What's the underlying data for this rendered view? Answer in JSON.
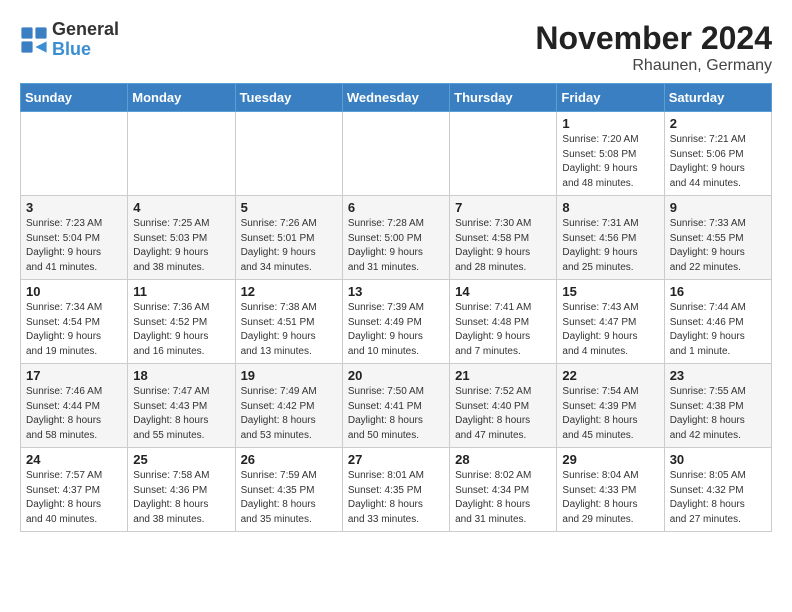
{
  "logo": {
    "general": "General",
    "blue": "Blue"
  },
  "header": {
    "month": "November 2024",
    "location": "Rhaunen, Germany"
  },
  "days_of_week": [
    "Sunday",
    "Monday",
    "Tuesday",
    "Wednesday",
    "Thursday",
    "Friday",
    "Saturday"
  ],
  "weeks": [
    [
      {
        "day": "",
        "info": ""
      },
      {
        "day": "",
        "info": ""
      },
      {
        "day": "",
        "info": ""
      },
      {
        "day": "",
        "info": ""
      },
      {
        "day": "",
        "info": ""
      },
      {
        "day": "1",
        "info": "Sunrise: 7:20 AM\nSunset: 5:08 PM\nDaylight: 9 hours\nand 48 minutes."
      },
      {
        "day": "2",
        "info": "Sunrise: 7:21 AM\nSunset: 5:06 PM\nDaylight: 9 hours\nand 44 minutes."
      }
    ],
    [
      {
        "day": "3",
        "info": "Sunrise: 7:23 AM\nSunset: 5:04 PM\nDaylight: 9 hours\nand 41 minutes."
      },
      {
        "day": "4",
        "info": "Sunrise: 7:25 AM\nSunset: 5:03 PM\nDaylight: 9 hours\nand 38 minutes."
      },
      {
        "day": "5",
        "info": "Sunrise: 7:26 AM\nSunset: 5:01 PM\nDaylight: 9 hours\nand 34 minutes."
      },
      {
        "day": "6",
        "info": "Sunrise: 7:28 AM\nSunset: 5:00 PM\nDaylight: 9 hours\nand 31 minutes."
      },
      {
        "day": "7",
        "info": "Sunrise: 7:30 AM\nSunset: 4:58 PM\nDaylight: 9 hours\nand 28 minutes."
      },
      {
        "day": "8",
        "info": "Sunrise: 7:31 AM\nSunset: 4:56 PM\nDaylight: 9 hours\nand 25 minutes."
      },
      {
        "day": "9",
        "info": "Sunrise: 7:33 AM\nSunset: 4:55 PM\nDaylight: 9 hours\nand 22 minutes."
      }
    ],
    [
      {
        "day": "10",
        "info": "Sunrise: 7:34 AM\nSunset: 4:54 PM\nDaylight: 9 hours\nand 19 minutes."
      },
      {
        "day": "11",
        "info": "Sunrise: 7:36 AM\nSunset: 4:52 PM\nDaylight: 9 hours\nand 16 minutes."
      },
      {
        "day": "12",
        "info": "Sunrise: 7:38 AM\nSunset: 4:51 PM\nDaylight: 9 hours\nand 13 minutes."
      },
      {
        "day": "13",
        "info": "Sunrise: 7:39 AM\nSunset: 4:49 PM\nDaylight: 9 hours\nand 10 minutes."
      },
      {
        "day": "14",
        "info": "Sunrise: 7:41 AM\nSunset: 4:48 PM\nDaylight: 9 hours\nand 7 minutes."
      },
      {
        "day": "15",
        "info": "Sunrise: 7:43 AM\nSunset: 4:47 PM\nDaylight: 9 hours\nand 4 minutes."
      },
      {
        "day": "16",
        "info": "Sunrise: 7:44 AM\nSunset: 4:46 PM\nDaylight: 9 hours\nand 1 minute."
      }
    ],
    [
      {
        "day": "17",
        "info": "Sunrise: 7:46 AM\nSunset: 4:44 PM\nDaylight: 8 hours\nand 58 minutes."
      },
      {
        "day": "18",
        "info": "Sunrise: 7:47 AM\nSunset: 4:43 PM\nDaylight: 8 hours\nand 55 minutes."
      },
      {
        "day": "19",
        "info": "Sunrise: 7:49 AM\nSunset: 4:42 PM\nDaylight: 8 hours\nand 53 minutes."
      },
      {
        "day": "20",
        "info": "Sunrise: 7:50 AM\nSunset: 4:41 PM\nDaylight: 8 hours\nand 50 minutes."
      },
      {
        "day": "21",
        "info": "Sunrise: 7:52 AM\nSunset: 4:40 PM\nDaylight: 8 hours\nand 47 minutes."
      },
      {
        "day": "22",
        "info": "Sunrise: 7:54 AM\nSunset: 4:39 PM\nDaylight: 8 hours\nand 45 minutes."
      },
      {
        "day": "23",
        "info": "Sunrise: 7:55 AM\nSunset: 4:38 PM\nDaylight: 8 hours\nand 42 minutes."
      }
    ],
    [
      {
        "day": "24",
        "info": "Sunrise: 7:57 AM\nSunset: 4:37 PM\nDaylight: 8 hours\nand 40 minutes."
      },
      {
        "day": "25",
        "info": "Sunrise: 7:58 AM\nSunset: 4:36 PM\nDaylight: 8 hours\nand 38 minutes."
      },
      {
        "day": "26",
        "info": "Sunrise: 7:59 AM\nSunset: 4:35 PM\nDaylight: 8 hours\nand 35 minutes."
      },
      {
        "day": "27",
        "info": "Sunrise: 8:01 AM\nSunset: 4:35 PM\nDaylight: 8 hours\nand 33 minutes."
      },
      {
        "day": "28",
        "info": "Sunrise: 8:02 AM\nSunset: 4:34 PM\nDaylight: 8 hours\nand 31 minutes."
      },
      {
        "day": "29",
        "info": "Sunrise: 8:04 AM\nSunset: 4:33 PM\nDaylight: 8 hours\nand 29 minutes."
      },
      {
        "day": "30",
        "info": "Sunrise: 8:05 AM\nSunset: 4:32 PM\nDaylight: 8 hours\nand 27 minutes."
      }
    ]
  ]
}
